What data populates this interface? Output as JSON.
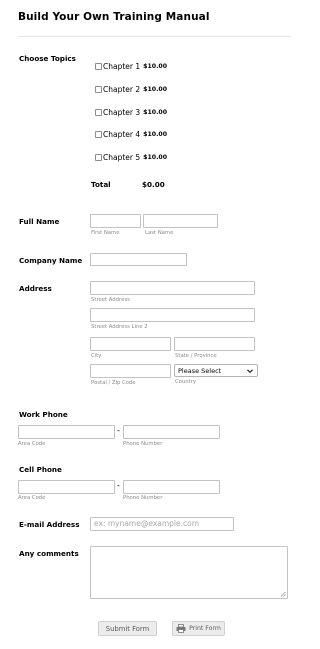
{
  "form": {
    "title": "Build Your Own Training Manual",
    "topics": {
      "label": "Choose Topics",
      "items": [
        {
          "name": "Chapter 1",
          "price": "$10.00"
        },
        {
          "name": "Chapter 2",
          "price": "$10.00"
        },
        {
          "name": "Chapter 3",
          "price": "$10.00"
        },
        {
          "name": "Chapter 4",
          "price": "$10.00"
        },
        {
          "name": "Chapter 5",
          "price": "$10.00"
        }
      ],
      "total_label": "Total",
      "total_value": "$0.00"
    },
    "full_name": {
      "label": "Full Name",
      "first_sub": "First Name",
      "last_sub": "Last Name"
    },
    "company": {
      "label": "Company Name"
    },
    "address": {
      "label": "Address",
      "street_sub": "Street Address",
      "street2_sub": "Street Address Line 2",
      "city_sub": "City",
      "state_sub": "State / Province",
      "zip_sub": "Postal / Zip Code",
      "country_sub": "Country",
      "country_value": "Please Select"
    },
    "work_phone": {
      "label": "Work Phone",
      "area_sub": "Area Code",
      "number_sub": "Phone Number",
      "separator": "-"
    },
    "cell_phone": {
      "label": "Cell Phone",
      "area_sub": "Area Code",
      "number_sub": "Phone Number",
      "separator": "-"
    },
    "email": {
      "label": "E-mail Address",
      "placeholder": "ex: myname@example.com"
    },
    "comments": {
      "label": "Any comments"
    },
    "buttons": {
      "submit": "Submit Form",
      "print": "Print Form"
    }
  },
  "icons": {
    "checkbox": "checkbox-icon",
    "select_arrow": "chevron-down-icon",
    "print": "printer-icon",
    "resize": "resize-grip-icon"
  }
}
